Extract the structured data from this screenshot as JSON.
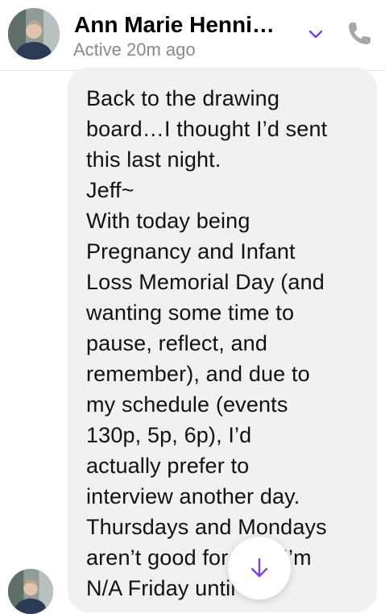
{
  "header": {
    "contact_name": "Ann Marie Henni…",
    "status": "Active 20m ago",
    "chevron_icon": "chevron-down-icon",
    "call_icon": "phone-icon"
  },
  "message": {
    "lines": [
      "Back to the drawing",
      "board…I thought I’d sent",
      "this last night.",
      "Jeff~",
      "With today being",
      "Pregnancy and Infant",
      "Loss Memorial Day (and",
      "wanting some time to",
      "pause, reflect, and",
      "remember), and due to",
      "my schedule (events",
      "130p, 5p, 6p), I’d",
      "actually prefer to",
      "interview another day.",
      "Thursdays and Mondays",
      "aren’t good for you. I’m",
      "N/A Friday until 30-"
    ]
  },
  "scroll_button": {
    "icon": "arrow-down-icon"
  },
  "colors": {
    "accent": "#7b3fe4",
    "icon_gray": "#a6a6ab",
    "bubble": "#f1f1f2",
    "status_text": "#8a8a8e"
  }
}
